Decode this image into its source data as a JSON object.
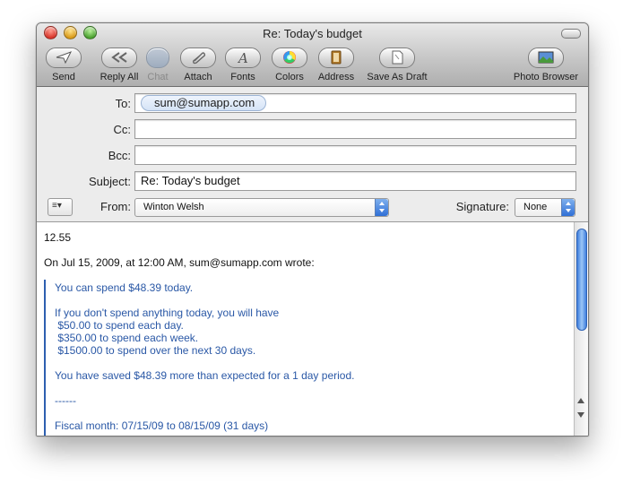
{
  "window": {
    "title": "Re: Today's budget"
  },
  "toolbar": {
    "send": "Send",
    "reply_all": "Reply All",
    "chat": "Chat",
    "attach": "Attach",
    "fonts": "Fonts",
    "colors": "Colors",
    "address": "Address",
    "save_draft": "Save As Draft",
    "photo_browser": "Photo Browser"
  },
  "headers": {
    "to_label": "To:",
    "to_value": "sum@sumapp.com",
    "cc_label": "Cc:",
    "cc_value": "",
    "bcc_label": "Bcc:",
    "bcc_value": "",
    "subject_label": "Subject:",
    "subject_value": "Re: Today's budget",
    "from_label": "From:",
    "from_value": "Winton Welsh",
    "signature_label": "Signature:",
    "signature_value": "None"
  },
  "body": {
    "reply_line": "12.55",
    "attribution": "On Jul 15, 2009, at 12:00 AM, sum@sumapp.com wrote:",
    "quoted": [
      "You can spend $48.39 today.",
      "",
      "If you don't spend anything today, you will have",
      " $50.00 to spend each day.",
      " $350.00 to spend each week.",
      " $1500.00 to spend over the next 30 days.",
      "",
      "You have saved $48.39 more than expected for a 1 day period.",
      "",
      "------",
      "",
      "Fiscal month: 07/15/09 to 08/15/09 (31 days)"
    ]
  },
  "colors": {
    "quote_text": "#2a58a6",
    "quote_bar": "#2d5fb0",
    "accent": "#3f7fdd"
  }
}
